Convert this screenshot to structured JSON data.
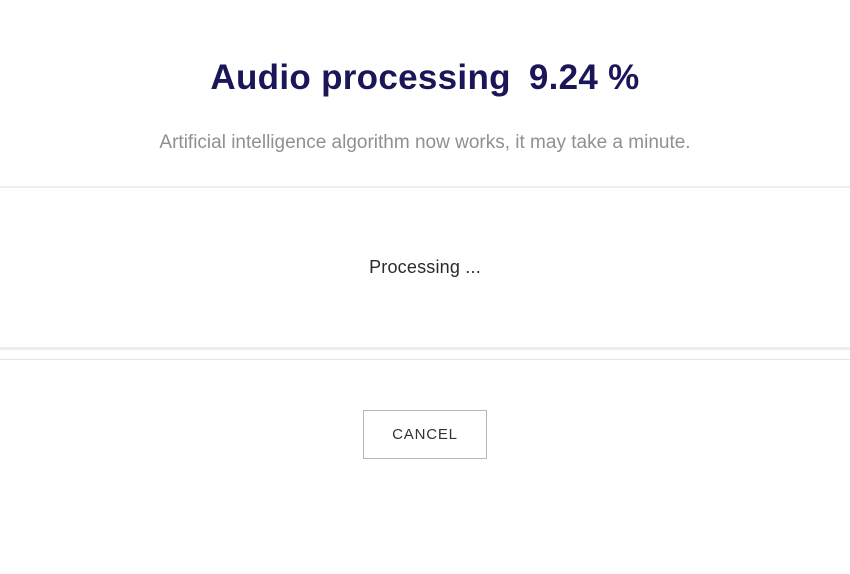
{
  "header": {
    "title_label": "Audio processing",
    "percent_display": "9.24 %",
    "subtitle": "Artificial intelligence algorithm now works, it may take a minute."
  },
  "status": {
    "processing_text": "Processing ..."
  },
  "actions": {
    "cancel_label": "CANCEL"
  }
}
